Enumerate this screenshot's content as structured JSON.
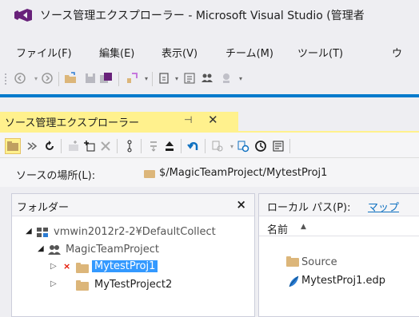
{
  "window": {
    "title": "ソース管理エクスプローラー - Microsoft Visual Studio (管理者"
  },
  "menu": {
    "items": [
      {
        "label": "ファイル(F)"
      },
      {
        "label": "編集(E)"
      },
      {
        "label": "表示(V)"
      },
      {
        "label": "チーム(M)"
      },
      {
        "label": "ツール(T)"
      },
      {
        "label": "ウ"
      }
    ]
  },
  "toolbar": {
    "icons": [
      "back-icon",
      "forward-icon",
      "open-folder-icon",
      "save-icon",
      "save-all-icon",
      "find-icon",
      "new-file-icon",
      "solution-explorer-icon",
      "team-explorer-icon"
    ]
  },
  "tab": {
    "label": "ソース管理エクスプローラー",
    "pin": "⊣",
    "close": "✕"
  },
  "location": {
    "label": "ソースの場所(L):",
    "path": "$/MagicTeamProject/MytestProj1"
  },
  "folders_pane": {
    "title": "フォルダー",
    "close": "×",
    "tree": [
      {
        "label": "vmwin2012r2-2¥DefaultCollect",
        "expanded": true
      },
      {
        "label": "MagicTeamProject",
        "expanded": true
      },
      {
        "label": "MytestProj1",
        "selected": true,
        "status": "×"
      },
      {
        "label": "MyTestProject2"
      }
    ]
  },
  "files_pane": {
    "local_path_label": "ローカル パス(P):",
    "local_path_link": "マップ",
    "column_name": "名前",
    "sort_arrow": "▲",
    "files": [
      {
        "name": "Source",
        "icon": "folder-icon"
      },
      {
        "name": "MytestProj1.edp",
        "icon": "edp-file-icon"
      }
    ]
  },
  "colors": {
    "accent": "#007acc",
    "tab_active": "#fff18d",
    "selection": "#3399ff",
    "folder": "#dcb67a",
    "link": "#0e70c0"
  }
}
